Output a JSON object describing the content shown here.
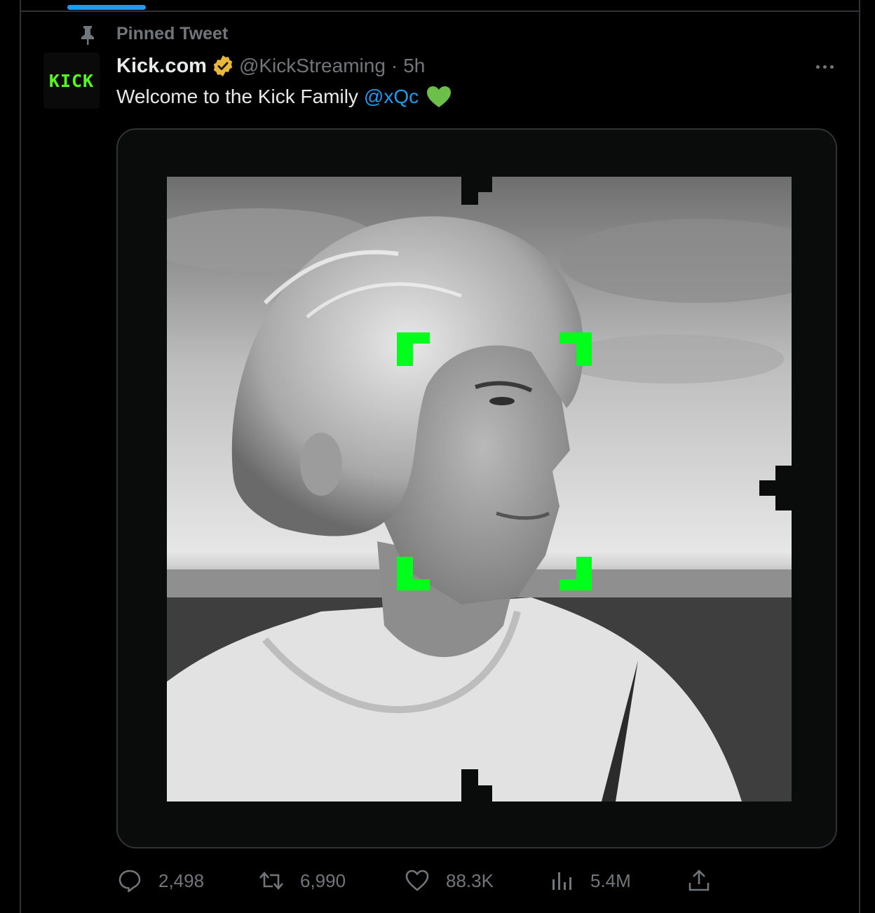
{
  "pinned": {
    "label": "Pinned Tweet"
  },
  "author": {
    "avatar_text": "KICK",
    "display_name": "Kick.com",
    "handle": "@KickStreaming",
    "separator": "·",
    "time": "5h"
  },
  "tweet": {
    "text": "Welcome to the Kick Family",
    "mention": "@xQc"
  },
  "stats": {
    "replies": "2,498",
    "retweets": "6,990",
    "likes": "88.3K",
    "views": "5.4M"
  },
  "colors": {
    "accent": "#1d9bf0",
    "brand_green": "#53fc18",
    "frame_green": "#00ff1a",
    "verified_gold": "#e8b83a",
    "muted": "#71767b"
  },
  "icons": {
    "pin": "pin-icon",
    "verified": "verified-badge-icon",
    "more": "more-icon",
    "reply": "reply-icon",
    "retweet": "retweet-icon",
    "like": "heart-icon",
    "views": "views-icon",
    "share": "share-icon"
  }
}
